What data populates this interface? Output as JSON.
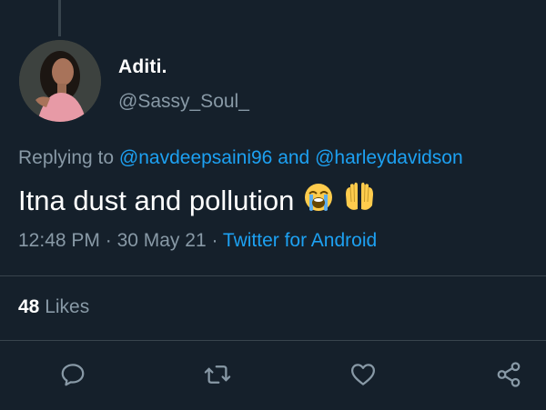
{
  "tweet": {
    "author_name": "Aditi.",
    "author_handle": "@Sassy_Soul_",
    "reply_prefix": "Replying to ",
    "reply_to_1": "@navdeepsaini96",
    "reply_joiner": " and ",
    "reply_to_2": "@harleydavidson",
    "text": "Itna dust and pollution",
    "emojis": [
      "loudly-crying-face",
      "raising-hands"
    ],
    "time": "12:48 PM",
    "separator": " · ",
    "date": "30 May 21",
    "source": "Twitter for Android"
  },
  "stats": {
    "likes_count": "48",
    "likes_label": " Likes"
  },
  "actions": {
    "icons": [
      "reply-icon",
      "retweet-icon",
      "like-icon",
      "share-icon"
    ]
  },
  "colors": {
    "background": "#15202b",
    "primary_text": "#ffffff",
    "secondary_text": "#8899a6",
    "accent": "#1da1f2",
    "divider": "#38444d"
  }
}
